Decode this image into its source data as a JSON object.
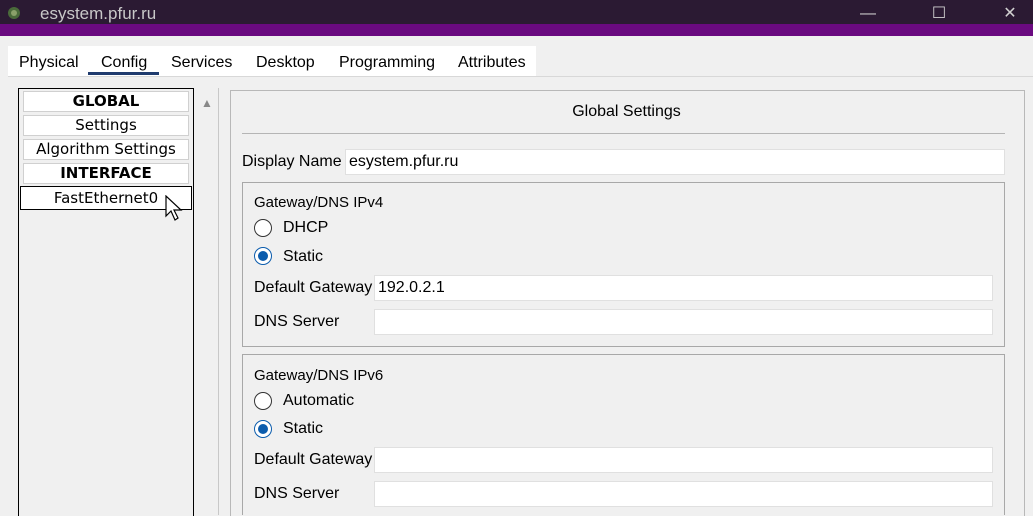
{
  "window": {
    "title": "esystem.pfur.ru",
    "minimize": "—",
    "maximize": "☐",
    "close": "✕"
  },
  "tabs": [
    {
      "label": "Physical"
    },
    {
      "label": "Config"
    },
    {
      "label": "Services"
    },
    {
      "label": "Desktop"
    },
    {
      "label": "Programming"
    },
    {
      "label": "Attributes"
    }
  ],
  "active_tab": "Config",
  "sidebar": {
    "items": [
      {
        "label": "GLOBAL"
      },
      {
        "label": "Settings"
      },
      {
        "label": "Algorithm Settings"
      },
      {
        "label": "INTERFACE"
      },
      {
        "label": "FastEthernet0"
      }
    ]
  },
  "main": {
    "title": "Global Settings",
    "display_name_label": "Display Name",
    "display_name_value": "esystem.pfur.ru",
    "ipv4": {
      "title": "Gateway/DNS IPv4",
      "dhcp_label": "DHCP",
      "static_label": "Static",
      "selected": "Static",
      "gateway_label": "Default Gateway",
      "gateway_value": "192.0.2.1",
      "dns_label": "DNS Server",
      "dns_value": ""
    },
    "ipv6": {
      "title": "Gateway/DNS IPv6",
      "auto_label": "Automatic",
      "static_label": "Static",
      "selected": "Static",
      "gateway_label": "Default Gateway",
      "gateway_value": "",
      "dns_label": "DNS Server",
      "dns_value": ""
    }
  },
  "colors": {
    "accent": "#0b5cad",
    "titlebar": "#2b1a33",
    "titlebar_strip": "#6a0a80",
    "tab_underline": "#1f3b6e"
  }
}
